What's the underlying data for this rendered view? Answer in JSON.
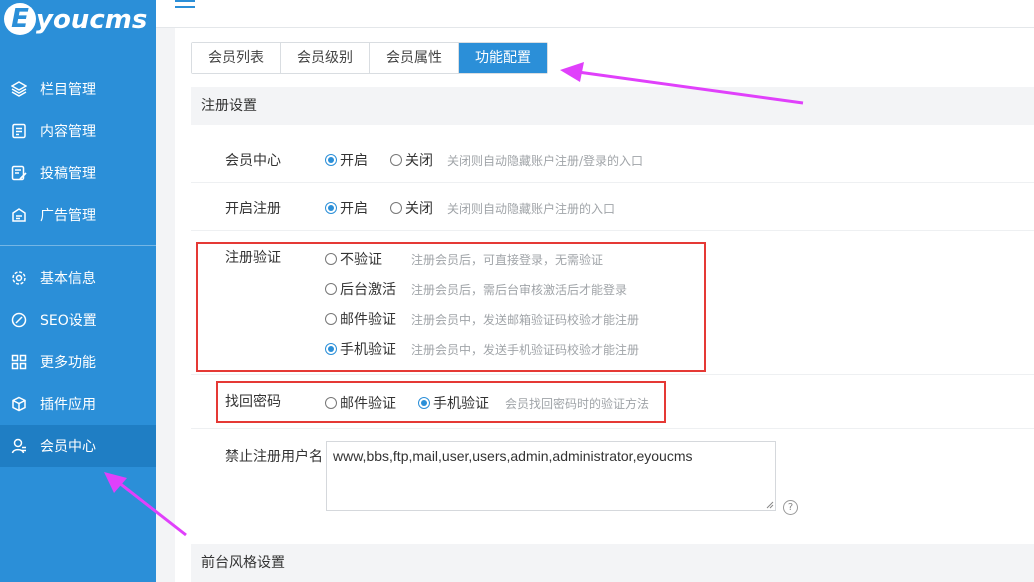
{
  "logo": {
    "badge": "E",
    "text": "youcms"
  },
  "sidebar": {
    "items": [
      {
        "label": "栏目管理",
        "icon": "layers-icon"
      },
      {
        "label": "内容管理",
        "icon": "document-icon"
      },
      {
        "label": "投稿管理",
        "icon": "edit-document-icon"
      },
      {
        "label": "广告管理",
        "icon": "ad-icon"
      },
      {
        "label": "基本信息",
        "icon": "gear-icon"
      },
      {
        "label": "SEO设置",
        "icon": "seo-icon"
      },
      {
        "label": "更多功能",
        "icon": "grid-icon"
      },
      {
        "label": "插件应用",
        "icon": "cube-icon"
      },
      {
        "label": "会员中心",
        "icon": "user-icon",
        "active": true
      }
    ]
  },
  "tabs": [
    {
      "label": "会员列表"
    },
    {
      "label": "会员级别"
    },
    {
      "label": "会员属性"
    },
    {
      "label": "功能配置",
      "active": true
    }
  ],
  "register_section": {
    "title": "注册设置"
  },
  "member_center": {
    "label": "会员中心",
    "options": [
      {
        "label": "开启",
        "checked": true
      },
      {
        "label": "关闭",
        "checked": false
      }
    ],
    "hint": "关闭则自动隐藏账户注册/登录的入口"
  },
  "open_register": {
    "label": "开启注册",
    "options": [
      {
        "label": "开启",
        "checked": true
      },
      {
        "label": "关闭",
        "checked": false
      }
    ],
    "hint": "关闭则自动隐藏账户注册的入口"
  },
  "register_verify": {
    "label": "注册验证",
    "options": [
      {
        "label": "不验证",
        "checked": false,
        "hint": "注册会员后，可直接登录，无需验证"
      },
      {
        "label": "后台激活",
        "checked": false,
        "hint": "注册会员后，需后台审核激活后才能登录"
      },
      {
        "label": "邮件验证",
        "checked": false,
        "hint": "注册会员中，发送邮箱验证码校验才能注册"
      },
      {
        "label": "手机验证",
        "checked": true,
        "hint": "注册会员中，发送手机验证码校验才能注册"
      }
    ]
  },
  "find_password": {
    "label": "找回密码",
    "options": [
      {
        "label": "邮件验证",
        "checked": false
      },
      {
        "label": "手机验证",
        "checked": true
      }
    ],
    "hint": "会员找回密码时的验证方法"
  },
  "banned_names": {
    "label": "禁止注册用户名",
    "value": "www,bbs,ftp,mail,user,users,admin,administrator,eyoucms",
    "help": "?"
  },
  "style_section": {
    "title": "前台风格设置"
  },
  "colors": {
    "sidebar": "#2b8fd8",
    "sidebar_active": "#1f7ec4",
    "accent": "#2b8fd8",
    "highlight_box": "#e53935",
    "arrow": "#e040fb"
  }
}
